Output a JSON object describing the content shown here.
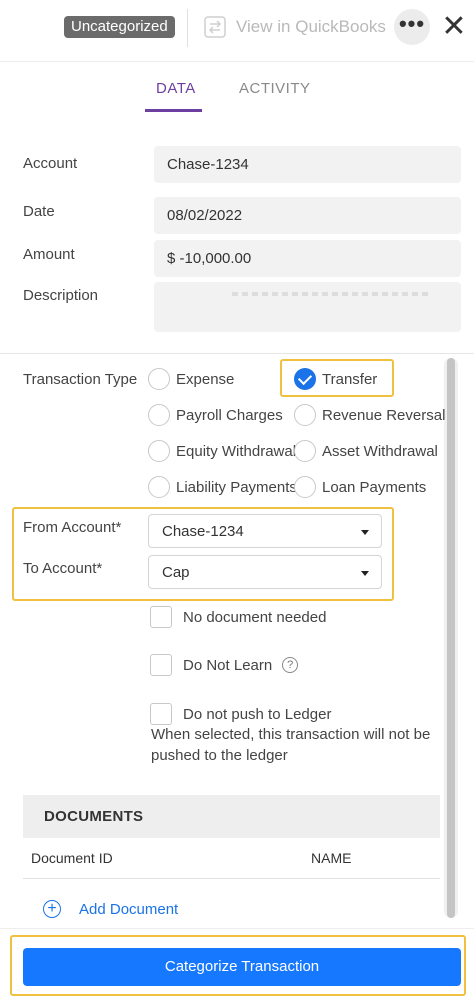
{
  "header": {
    "status_badge": "Uncategorized",
    "view_in_qb_label": "View in QuickBooks",
    "more_icon": "more-horizontal-icon",
    "close_icon": "close-icon",
    "close_glyph": "✕",
    "more_glyph": "•••"
  },
  "tabs": [
    {
      "label": "DATA",
      "active": true
    },
    {
      "label": "ACTIVITY",
      "active": false
    }
  ],
  "fields": {
    "account": {
      "label": "Account",
      "value": "Chase-1234"
    },
    "date": {
      "label": "Date",
      "value": "08/02/2022"
    },
    "amount": {
      "label": "Amount",
      "value": "$ -10,000.00"
    },
    "description": {
      "label": "Description",
      "value": ""
    }
  },
  "transaction_type": {
    "label": "Transaction Type",
    "options": [
      {
        "label": "Expense",
        "checked": false
      },
      {
        "label": "Transfer",
        "checked": true
      },
      {
        "label": "Payroll Charges",
        "checked": false
      },
      {
        "label": "Revenue Reversal",
        "checked": false
      },
      {
        "label": "Equity Withdrawal",
        "checked": false
      },
      {
        "label": "Asset Withdrawal",
        "checked": false
      },
      {
        "label": "Liability Payments",
        "checked": false
      },
      {
        "label": "Loan Payments",
        "checked": false
      }
    ]
  },
  "from_account": {
    "label": "From Account*",
    "value": "Chase-1234"
  },
  "to_account": {
    "label": "To Account*",
    "value": "Cap"
  },
  "checkboxes": {
    "no_document": "No document needed",
    "do_not_learn": "Do Not Learn",
    "do_not_push": "Do not push to Ledger",
    "help_glyph": "?"
  },
  "push_note": "When selected, this transaction will not be pushed to the ledger",
  "documents": {
    "title": "DOCUMENTS",
    "columns": [
      "Document ID",
      "NAME"
    ],
    "add_label": "Add Document",
    "add_glyph": "+"
  },
  "actions": {
    "categorize_label": "Categorize Transaction"
  },
  "colors": {
    "accent_purple": "#6d3fa0",
    "primary_blue": "#1677ff",
    "highlight_yellow": "#f0c040",
    "badge_gray": "#6b6b6b"
  }
}
